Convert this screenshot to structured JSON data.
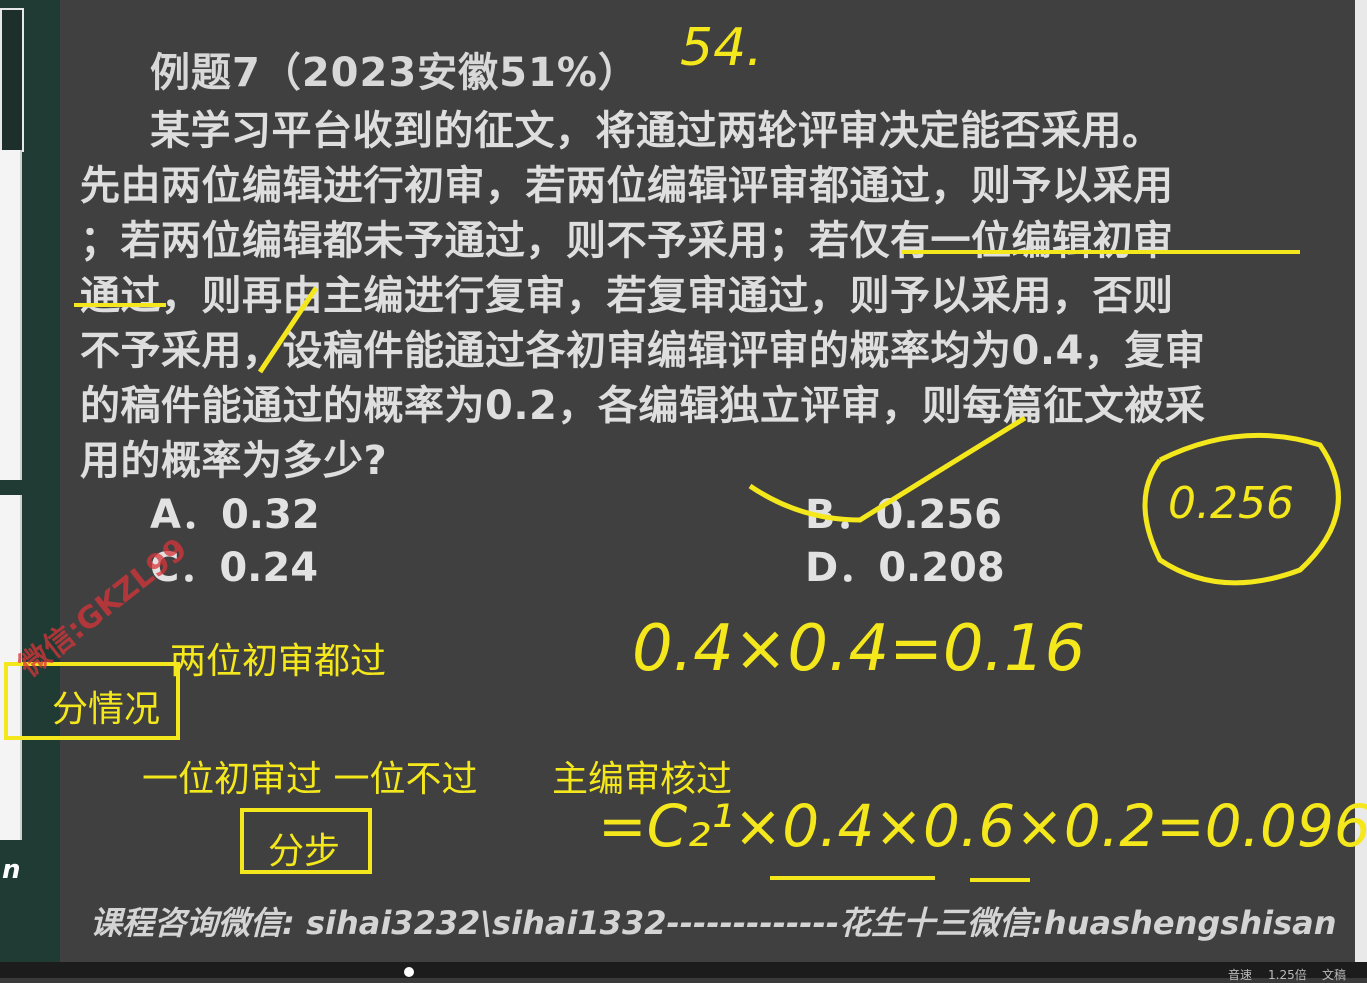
{
  "question": {
    "title": "例题7（2023安徽51%）",
    "lines": [
      "某学习平台收到的征文，将通过两轮评审决定能否采用。",
      "先由两位编辑进行初审，若两位编辑评审都通过，则予以采用",
      "；若两位编辑都未予通过，则不予采用；若仅有一位编辑初审",
      "通过，则再由主编进行复审，若复审通过，则予以采用，否则",
      "不予采用，设稿件能通过各初审编辑评审的概率均为0.4，复审",
      "的稿件能通过的概率为0.2，各编辑独立评审，则每篇征文被采",
      "用的概率为多少?"
    ],
    "options": {
      "a": "A．0.32",
      "b": "B．0.256",
      "c": "C．0.24",
      "d": "D．0.208"
    }
  },
  "annotations": {
    "time_note": "54.",
    "answer_circled": "0.256",
    "case_both": "两位初审都过",
    "case_label": "分情况",
    "case_one": "一位初审过 一位不过",
    "case_chief": "主编审核过",
    "step_label": "分步",
    "calc1": "0.4×0.4=0.16",
    "calc2": "=C₂¹×0.4×0.6×0.2=0.096"
  },
  "watermark": "微信:GKZL99",
  "footer": "课程咨询微信: sihai3232\\sihai1332-------------花生十三微信:huashengshisan",
  "side_letter": "n",
  "player": {
    "speed_label": "音速",
    "speed_value": "1.25倍",
    "doc_label": "文稿"
  },
  "colors": {
    "slide_bg": "#404040",
    "ink": "#f4e81c",
    "text": "#dedede"
  }
}
